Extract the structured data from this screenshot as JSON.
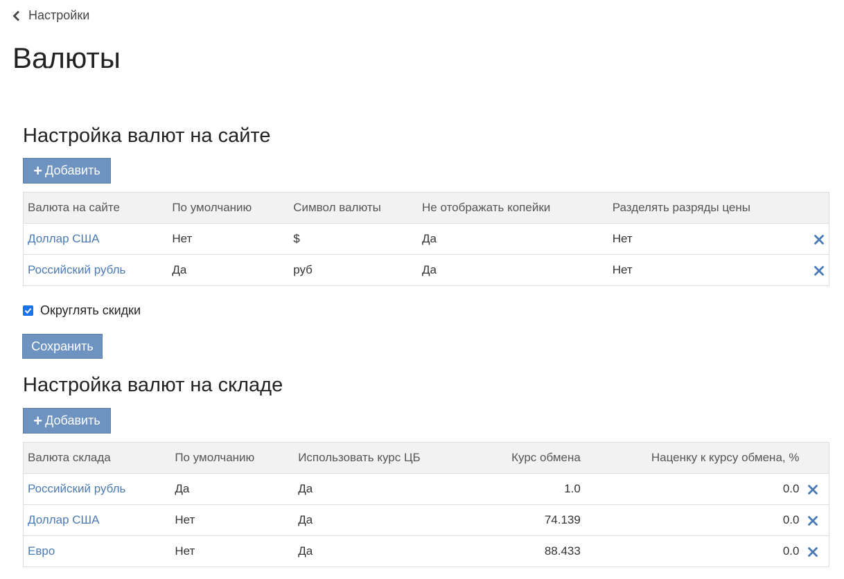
{
  "nav": {
    "back_label": "Настройки"
  },
  "page": {
    "title": "Валюты"
  },
  "site_section": {
    "title": "Настройка валют на сайте",
    "add_label": "Добавить",
    "columns": [
      "Валюта на сайте",
      "По умолчанию",
      "Символ валюты",
      "Не отображать копейки",
      "Разделять разряды цены"
    ],
    "rows": [
      {
        "name": "Доллар США",
        "default": "Нет",
        "symbol": "$",
        "hide_kopecks": "Да",
        "split_digits": "Нет"
      },
      {
        "name": "Российский рубль",
        "default": "Да",
        "symbol": "руб",
        "hide_kopecks": "Да",
        "split_digits": "Нет"
      }
    ],
    "round_discounts_label": "Округлять скидки",
    "round_discounts_checked": true,
    "save_label": "Сохранить"
  },
  "warehouse_section": {
    "title": "Настройка валют на складе",
    "add_label": "Добавить",
    "columns": [
      "Валюта склада",
      "По умолчанию",
      "Использовать курс ЦБ",
      "Курс обмена",
      "Наценку к курсу обмена, %"
    ],
    "rows": [
      {
        "name": "Российский рубль",
        "default": "Да",
        "use_cb_rate": "Да",
        "rate": "1.0",
        "markup": "0.0"
      },
      {
        "name": "Доллар США",
        "default": "Нет",
        "use_cb_rate": "Да",
        "rate": "74.139",
        "markup": "0.0"
      },
      {
        "name": "Евро",
        "default": "Нет",
        "use_cb_rate": "Да",
        "rate": "88.433",
        "markup": "0.0"
      }
    ]
  },
  "colors": {
    "accent": "#6e93c0",
    "link": "#4a7ab5",
    "header_bg": "#f2f2f2",
    "border": "#dddddd"
  },
  "icons": {
    "back": "chevron-left-icon",
    "add": "plus-icon",
    "delete": "close-icon",
    "checkbox": "check-icon"
  }
}
